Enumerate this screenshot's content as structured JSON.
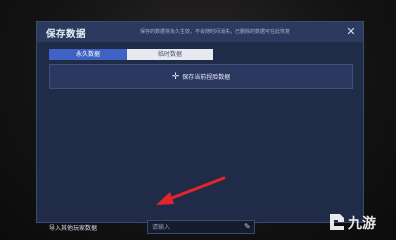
{
  "dialog": {
    "title": "保存数据",
    "notice": "保存的数据将永久生效，不会随时间消失，已删除的数据可在此恢复",
    "close_icon": "collapse-icon"
  },
  "tabs": [
    {
      "label": "永久数据",
      "active": true
    },
    {
      "label": "临时数据",
      "active": false
    }
  ],
  "save_button": {
    "label": "保存当前捏脸数据",
    "icon": "plus-icon"
  },
  "import": {
    "label": "导入其他玩家数据",
    "placeholder": "请输入",
    "icon": "edit-icon"
  },
  "annotation": {
    "arrow_color": "#e0262b"
  },
  "watermark": {
    "text": "九游",
    "icon": "nine-game-logo"
  },
  "colors": {
    "panel_bg": "#1f2b47",
    "tab_active": "#3f62c4",
    "arrow": "#e0262b"
  }
}
